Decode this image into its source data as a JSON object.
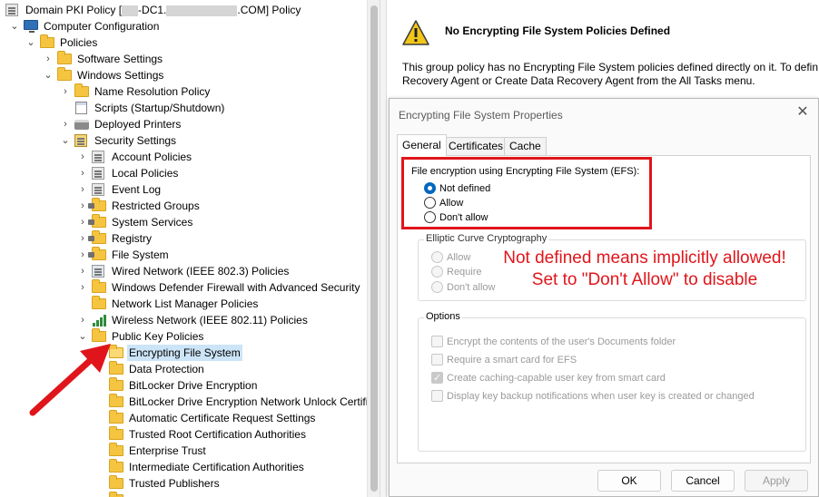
{
  "tree": {
    "title_prefix": "Domain PKI Policy [",
    "title_mid": "-DC1.",
    "title_suffix": ".COM] Policy",
    "items": [
      {
        "label": "Computer Configuration"
      },
      {
        "label": "Policies"
      },
      {
        "label": "Software Settings"
      },
      {
        "label": "Windows Settings"
      },
      {
        "label": "Name Resolution Policy"
      },
      {
        "label": "Scripts (Startup/Shutdown)"
      },
      {
        "label": "Deployed Printers"
      },
      {
        "label": "Security Settings"
      },
      {
        "label": "Account Policies"
      },
      {
        "label": "Local Policies"
      },
      {
        "label": "Event Log"
      },
      {
        "label": "Restricted Groups"
      },
      {
        "label": "System Services"
      },
      {
        "label": "Registry"
      },
      {
        "label": "File System"
      },
      {
        "label": "Wired Network (IEEE 802.3) Policies"
      },
      {
        "label": "Windows Defender Firewall with Advanced Security"
      },
      {
        "label": "Network List Manager Policies"
      },
      {
        "label": "Wireless Network (IEEE 802.11) Policies"
      },
      {
        "label": "Public Key Policies"
      },
      {
        "label": "Encrypting File System"
      },
      {
        "label": "Data Protection"
      },
      {
        "label": "BitLocker Drive Encryption"
      },
      {
        "label": "BitLocker Drive Encryption Network Unlock Certifi"
      },
      {
        "label": "Automatic Certificate Request Settings"
      },
      {
        "label": "Trusted Root Certification Authorities"
      },
      {
        "label": "Enterprise Trust"
      },
      {
        "label": "Intermediate Certification Authorities"
      },
      {
        "label": "Trusted Publishers"
      }
    ]
  },
  "details": {
    "title": "No Encrypting File System Policies Defined",
    "body_line1": "This group policy has no Encrypting File System policies defined directly on it. To defin",
    "body_line2": "Recovery Agent or Create Data Recovery Agent from the All Tasks menu."
  },
  "dialog": {
    "title": "Encrypting File System Properties",
    "close_glyph": "✕",
    "tabs": [
      "General",
      "Certificates",
      "Cache"
    ],
    "efs_group": {
      "caption": "File encryption using Encrypting File System (EFS):",
      "options": [
        "Not defined",
        "Allow",
        "Don't allow"
      ],
      "selected": "Not defined"
    },
    "ecc_group": {
      "caption": "Elliptic Curve Cryptography",
      "options": [
        "Allow",
        "Require",
        "Don't allow"
      ]
    },
    "options_group": {
      "caption": "Options",
      "checks": [
        {
          "label": "Encrypt the contents of the user's Documents folder",
          "checked": false
        },
        {
          "label": "Require a smart card for EFS",
          "checked": false
        },
        {
          "label": "Create caching-capable user key from smart card",
          "checked": true
        },
        {
          "label": "Display key backup notifications when user key is created or changed",
          "checked": false
        }
      ]
    },
    "buttons": {
      "ok": "OK",
      "cancel": "Cancel",
      "apply": "Apply"
    }
  },
  "annotation": {
    "line1": "Not defined means implicitly allowed!",
    "line2": "Set to \"Don't Allow\" to disable",
    "color": "#e0151b"
  },
  "colors": {
    "selection": "#cce4f7",
    "accent": "#0067c0",
    "folder": "#f5c542"
  }
}
